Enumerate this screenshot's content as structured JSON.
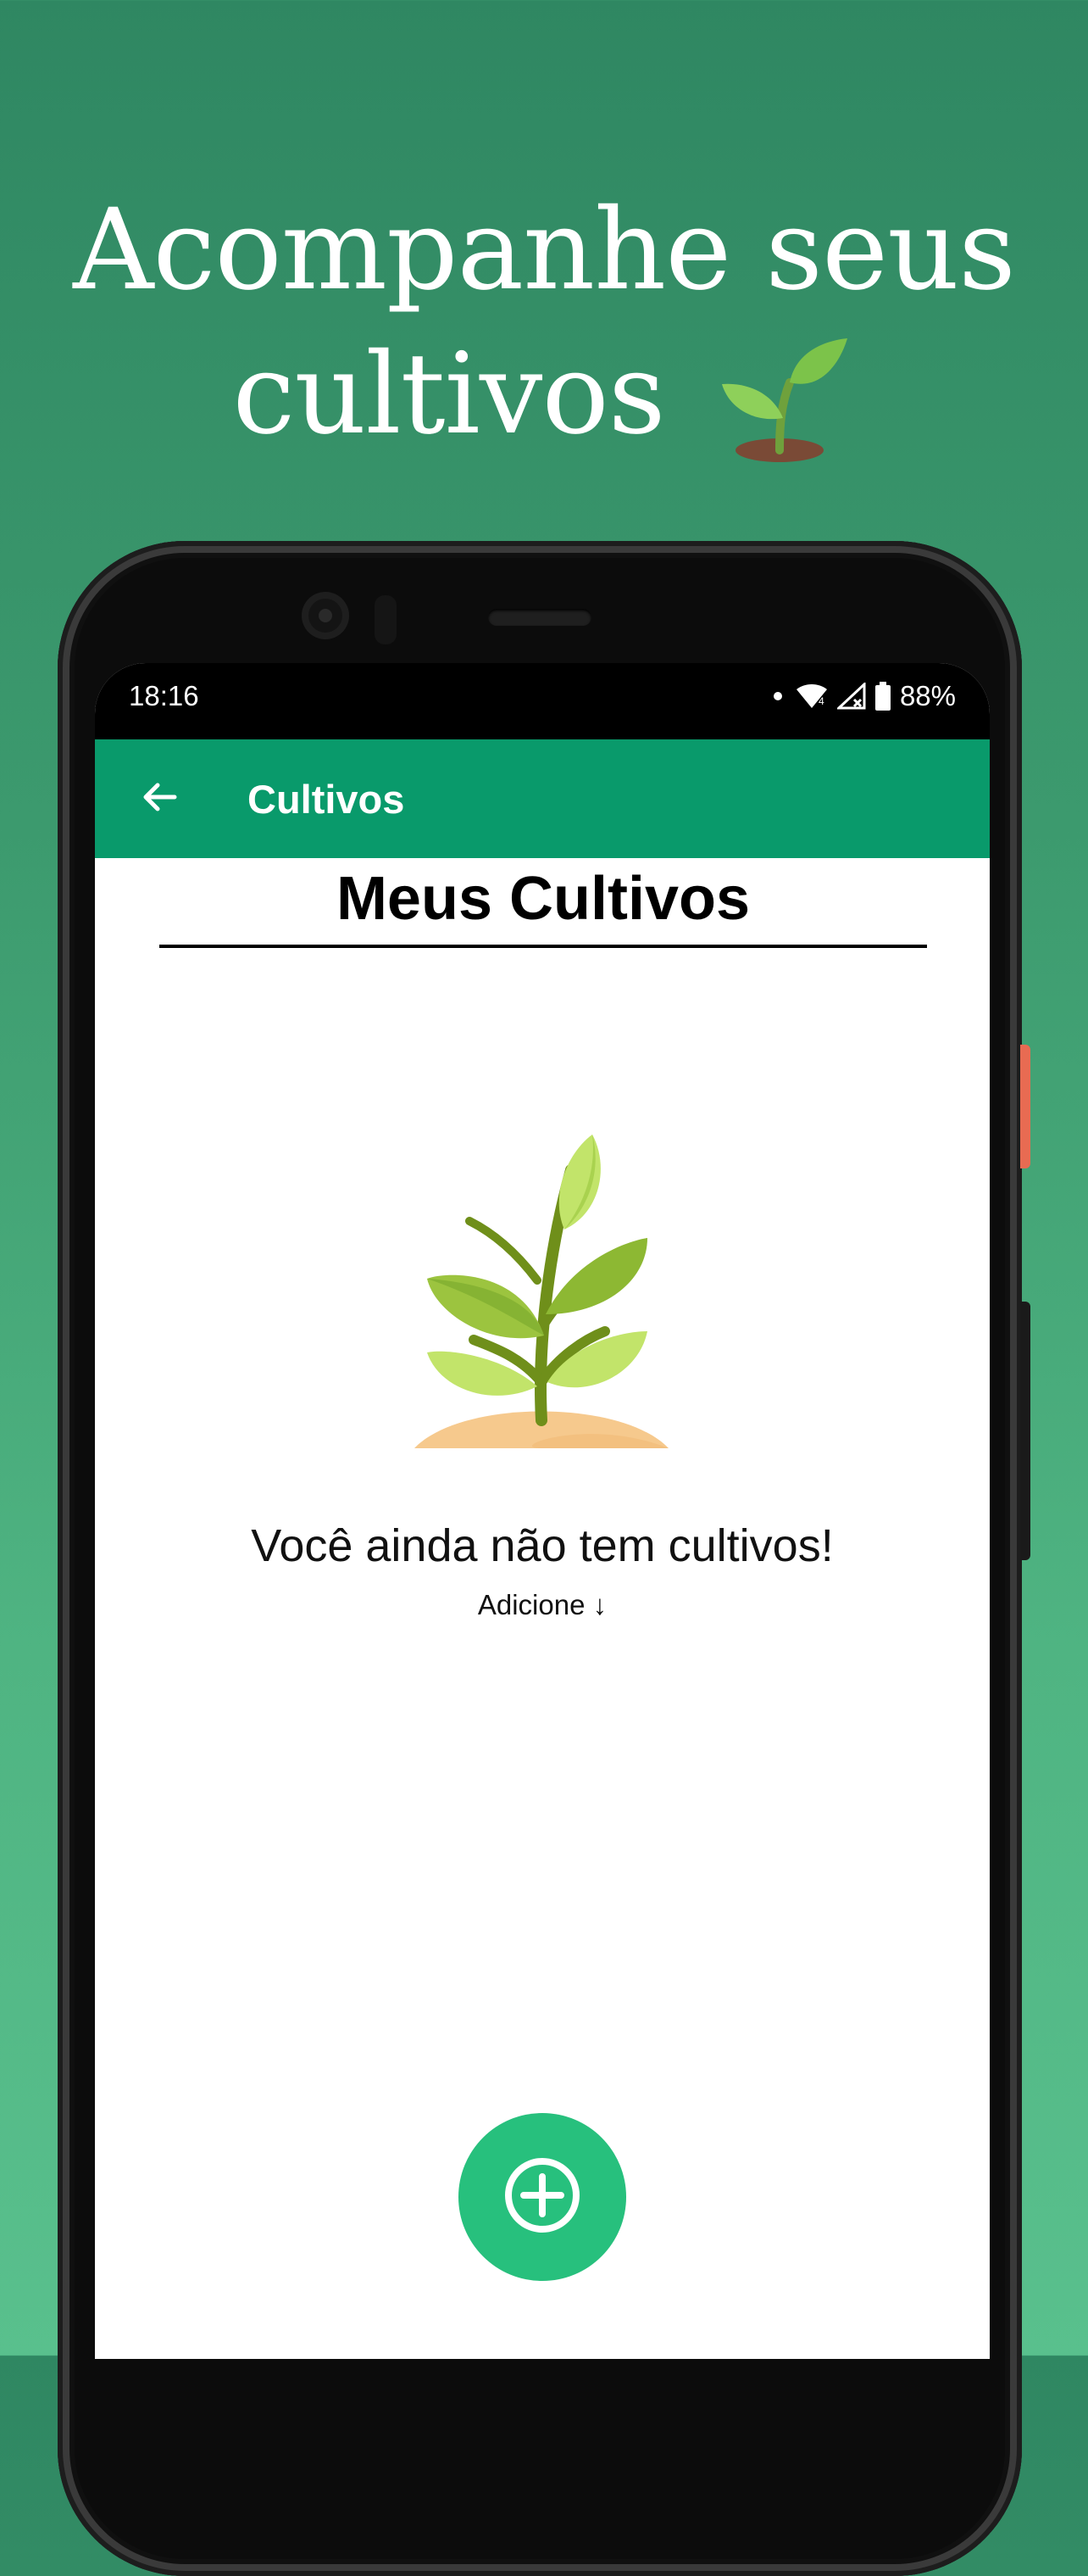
{
  "promo": {
    "headline_line1": "Acompanhe seus",
    "headline_line2": "cultivos"
  },
  "status_bar": {
    "time": "18:16",
    "battery": "88%"
  },
  "app_bar": {
    "title": "Cultivos"
  },
  "main": {
    "heading": "Meus Cultivos",
    "empty_message": "Você ainda não tem cultivos!",
    "empty_hint": "Adicione ↓"
  },
  "colors": {
    "background_top": "#2f8762",
    "background_bottom": "#59c08d",
    "app_bar": "#099a6b",
    "fab": "#27c07d"
  },
  "icons": {
    "back": "arrow-left-icon",
    "fab": "plus-circle-icon",
    "headline_emoji": "seedling-icon"
  }
}
